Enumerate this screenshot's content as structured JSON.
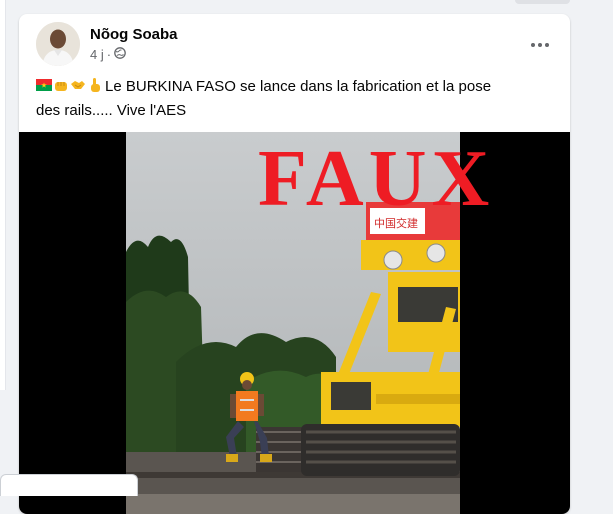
{
  "post": {
    "author": "Nõog Soaba",
    "time": "4 j",
    "meta_separator": "·",
    "privacy_icon": "globe-icon",
    "menu_icon": "more-horizontal-icon",
    "text_line1": "Le BURKINA FASO se lance dans la fabrication et la pose",
    "text_line2": "des rails..... Vive l'AES",
    "emojis": [
      "burkina-faso-flag-icon",
      "raised-fist-icon",
      "handshake-icon",
      "pointing-up-icon"
    ],
    "overlay_label": "FAUX",
    "machine_sign": "中国交建"
  },
  "colors": {
    "overlay_red": "#ee1c24",
    "text": "#050505",
    "secondary_text": "#65676b",
    "machine_yellow": "#f2c418"
  }
}
